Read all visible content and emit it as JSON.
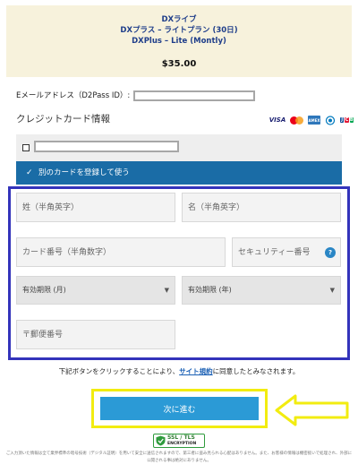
{
  "plan": {
    "line1": "DXライブ",
    "line2": "DXプラス – ライトプラン (30日)",
    "line3": "DXPlus – Lite (Montly)",
    "price": "$35.00"
  },
  "email": {
    "label": "Eメールアドレス（D2Pass ID）:"
  },
  "credit_card": {
    "heading": "クレジットカード情報",
    "logos": [
      "VISA",
      "mastercard",
      "AMEX",
      "Diners Club",
      "JCB"
    ]
  },
  "saved_card": {
    "checkbox_glyph": "❏"
  },
  "new_card": {
    "check_glyph": "✓",
    "label": "別のカードを登録して使う"
  },
  "form": {
    "last_name_placeholder": "姓（半角英字）",
    "first_name_placeholder": "名（半角英字）",
    "card_number_placeholder": "カード番号（半角数字）",
    "security_code_placeholder": "セキュリティー番号",
    "security_help": "?",
    "expiry_month": "有効期限 (月)",
    "expiry_year": "有効期限 (年)",
    "postal_placeholder": "〒郵便番号"
  },
  "agreement": {
    "before": "下記ボタンをクリックすることにより、",
    "link": "サイト規約",
    "after": "に同意したとみなされます。"
  },
  "submit": {
    "label": "次に進む"
  },
  "ssl": {
    "line1": "SSL / TLS",
    "line2": "ENCRYPTION"
  },
  "footnote": "ご入力頂いた情報は全て業界標準の暗号技術（デジタル証明）を用いて安全に送信されますので、第三者に盗み見られる心配はありません。また、お客様の情報は機密扱いで処理され、外部に公開される事は絶対にありません。",
  "colors": {
    "plan_bg": "#f7f2dc",
    "bar_blue": "#1a6ca6",
    "button_blue": "#2b9ad6",
    "frame_blue": "#3333bb",
    "highlight_yellow": "#f2ec10"
  }
}
